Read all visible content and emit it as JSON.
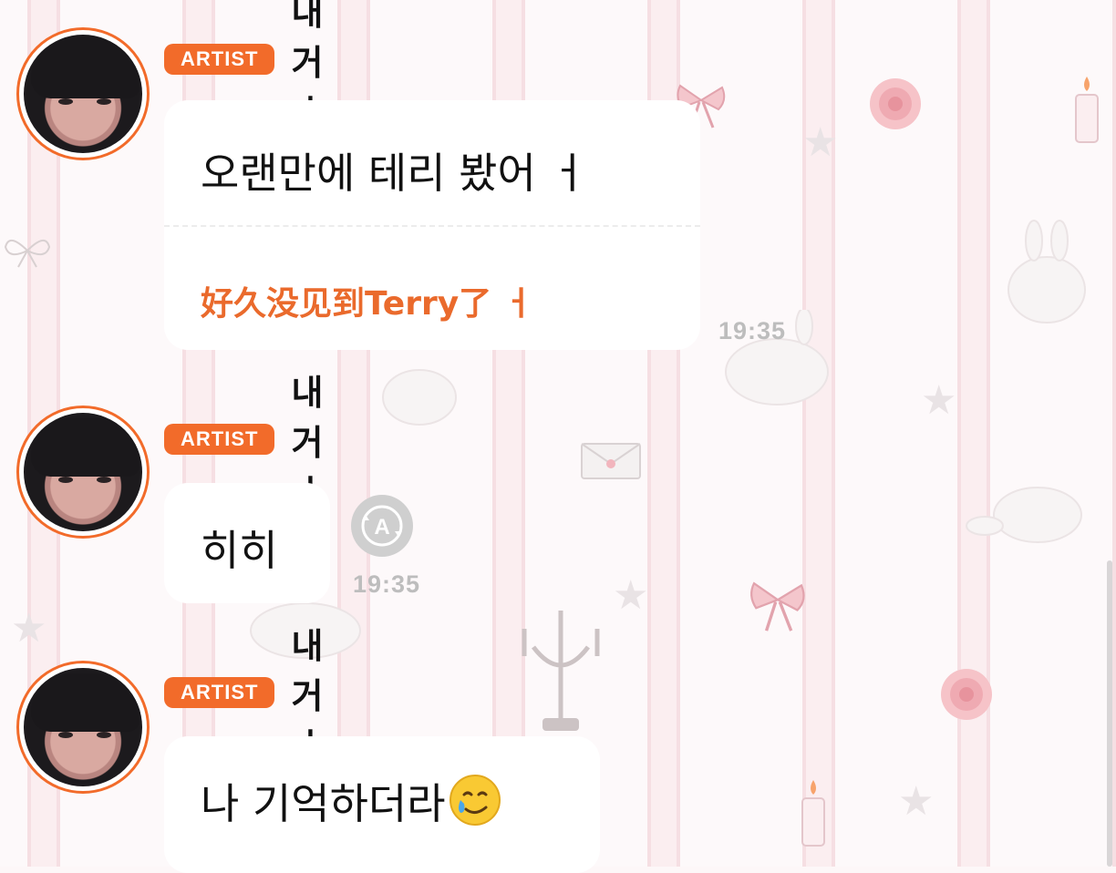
{
  "messages": [
    {
      "badge": "ARTIST",
      "username": "내 거 ㅓ",
      "text": "오랜만에 테리 봤어 ㅓ",
      "translation": "好久没见到Terry了 ㅓ",
      "time": "19:35"
    },
    {
      "badge": "ARTIST",
      "username": "내 거 ㅓ",
      "text": "히히",
      "time": "19:35"
    },
    {
      "badge": "ARTIST",
      "username": "내 거 ㅓ",
      "text": "나 기억하더라"
    }
  ],
  "icons": {
    "avatar": "artist-avatar",
    "translate": "translate-icon",
    "emoji": "smiling-face-with-tear"
  },
  "colors": {
    "accent": "#f26b2a",
    "translation": "#ea6a2c",
    "timestamp": "#bdbdbd"
  }
}
